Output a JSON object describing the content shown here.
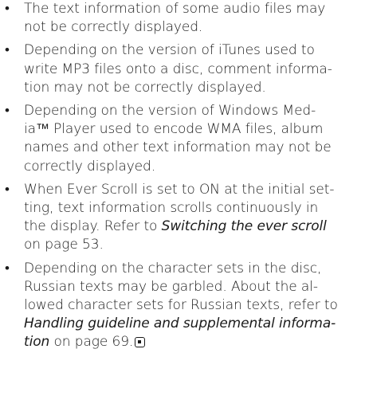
{
  "bullets": [
    {
      "lines": [
        "The text information of some audio files may",
        "not be correctly displayed."
      ]
    },
    {
      "lines": [
        "Depending on the version of iTunes used to",
        "write MP3 files onto a disc, comment informa-",
        "tion may not be correctly displayed."
      ]
    },
    {
      "lines": [
        "Depending on the version of Windows Med-",
        "ia™ Player used to encode WMA files, album",
        "names and other text information may not be",
        "correctly displayed."
      ]
    },
    {
      "lines": [
        "When Ever Scroll is set to ON at the initial set-",
        "ting, text information scrolls continuously in",
        "the display. Refer to "
      ],
      "link": "Switching the ever scroll",
      "tail": "on page 53."
    },
    {
      "lines": [
        "Depending on the character sets in the disc,",
        "Russian texts may be garbled. About the al-",
        "lowed character sets for Russian texts, refer to"
      ],
      "link_line_1": "Handling guideline and supplemental informa-",
      "link_line_2": "tion",
      "tail": " on page 69.",
      "end_icon": "end-of-section-icon"
    }
  ],
  "bullet_glyph": "•"
}
